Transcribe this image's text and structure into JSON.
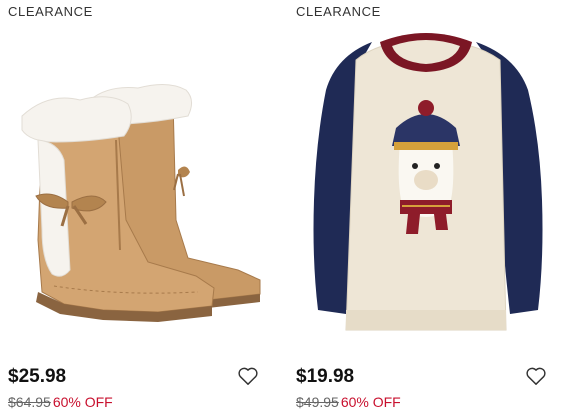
{
  "products": [
    {
      "badge": "CLEARANCE",
      "image_icon": "tan-suede-boot-with-faux-fur-icon",
      "price": "$25.98",
      "original_price": "$64.95",
      "discount": "60% OFF",
      "favorite_icon": "heart-outline-icon"
    },
    {
      "badge": "CLEARANCE",
      "image_icon": "llama-sweatshirt-icon",
      "price": "$19.98",
      "original_price": "$49.95",
      "discount": "60% OFF",
      "favorite_icon": "heart-outline-icon"
    }
  ],
  "colors": {
    "sale_red": "#c8102e",
    "text": "#111111",
    "muted": "#666666"
  }
}
